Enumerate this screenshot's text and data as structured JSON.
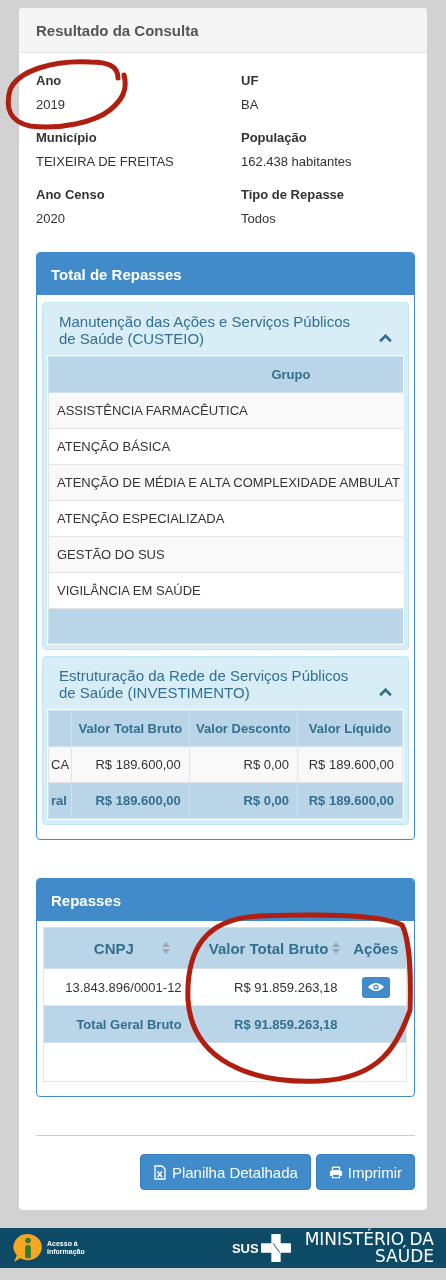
{
  "result": {
    "title": "Resultado da Consulta",
    "fields": [
      {
        "label": "Ano",
        "value": "2019"
      },
      {
        "label": "UF",
        "value": "BA"
      },
      {
        "label": "Município",
        "value": "TEIXEIRA DE FREITAS"
      },
      {
        "label": "População",
        "value": "162.438 habitantes"
      },
      {
        "label": "Ano Censo",
        "value": "2020"
      },
      {
        "label": "Tipo de Repasse",
        "value": "Todos"
      }
    ]
  },
  "total_repasses": {
    "title": "Total de Repasses",
    "sections": [
      {
        "kind": "groups",
        "title": "Manutenção das Ações e Serviços Públicos de Saúde (CUSTEIO)",
        "expanded": true,
        "column": "Grupo",
        "rows": [
          "ASSISTÊNCIA FARMACÊUTICA",
          "ATENÇÃO BÁSICA",
          "ATENÇÃO DE MÉDIA E ALTA COMPLEXIDADE AMBULAT",
          "ATENÇÃO ESPECIALIZADA",
          "GESTÃO DO SUS",
          "VIGILÂNCIA EM SAÚDE"
        ]
      },
      {
        "kind": "values",
        "title": "Estruturação da Rede de Serviços Públicos de Saúde (INVESTIMENTO)",
        "expanded": true,
        "columns": [
          "",
          "Valor Total Bruto",
          "Valor Desconto",
          "Valor Líquido"
        ],
        "rows": [
          [
            "CA",
            "R$ 189.600,00",
            "R$ 0,00",
            "R$ 189.600,00"
          ]
        ],
        "total": [
          "ral",
          "R$ 189.600,00",
          "R$ 0,00",
          "R$ 189.600,00"
        ]
      }
    ]
  },
  "repasses": {
    "title": "Repasses",
    "columns": [
      {
        "label": "CNPJ",
        "sortable": true
      },
      {
        "label": "Valor Total Bruto",
        "sortable": true
      },
      {
        "label": "Ações",
        "sortable": false
      }
    ],
    "rows": [
      {
        "cnpj": "13.843.896/0001-12",
        "value": "R$ 91.859.263,18"
      }
    ],
    "total": {
      "label": "Total Geral Bruto",
      "value": "R$ 91.859.263,18"
    }
  },
  "buttons": [
    {
      "label": "Planilha Detalhada",
      "kind": "spreadsheet"
    },
    {
      "label": "Imprimir",
      "kind": "print"
    }
  ],
  "footer": {
    "access_lines": [
      "Acesso à",
      "Informação"
    ],
    "sus": "SUS",
    "ministry_lines": [
      "MINISTÉRIO DA",
      "SAÚDE"
    ]
  }
}
